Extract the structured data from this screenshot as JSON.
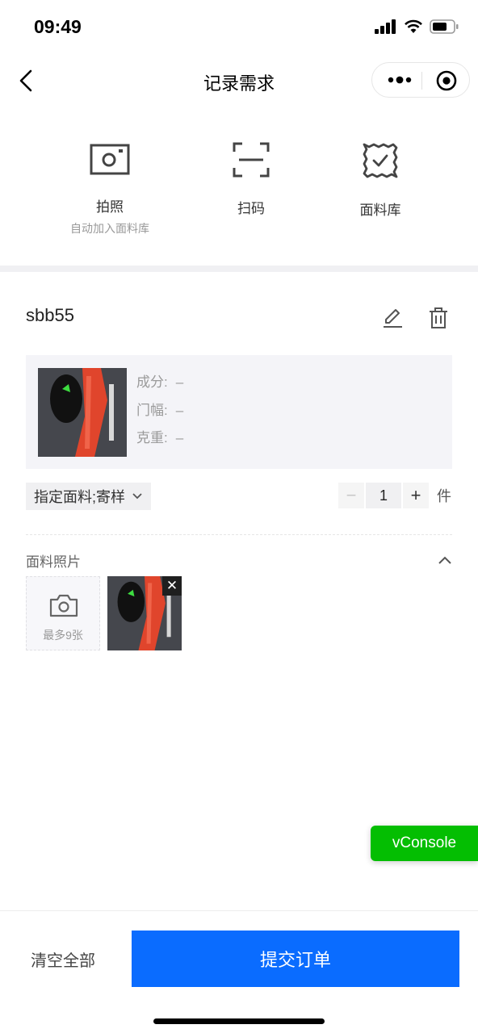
{
  "status_bar": {
    "time": "09:49"
  },
  "nav": {
    "title": "记录需求"
  },
  "actions": [
    {
      "label": "拍照",
      "sub": "自动加入面料库",
      "icon": "camera-icon"
    },
    {
      "label": "扫码",
      "sub": "",
      "icon": "scan-icon"
    },
    {
      "label": "面料库",
      "sub": "",
      "icon": "fabric-library-icon"
    }
  ],
  "item": {
    "name": "sbb55",
    "specs": [
      {
        "label": "成分:",
        "value": "–"
      },
      {
        "label": "门幅:",
        "value": "–"
      },
      {
        "label": "克重:",
        "value": "–"
      }
    ],
    "tag": "指定面料;寄样",
    "quantity": "1",
    "unit": "件"
  },
  "photos": {
    "label": "面料照片",
    "upload_hint": "最多9张",
    "remove_symbol": "✕"
  },
  "stepper": {
    "minus": "−",
    "plus": "+"
  },
  "vconsole": "vConsole",
  "footer": {
    "clear_label": "清空全部",
    "submit_label": "提交订单"
  },
  "colors": {
    "primary": "#0a6cff",
    "vconsole": "#04be02",
    "panel": "#f4f4f8"
  }
}
